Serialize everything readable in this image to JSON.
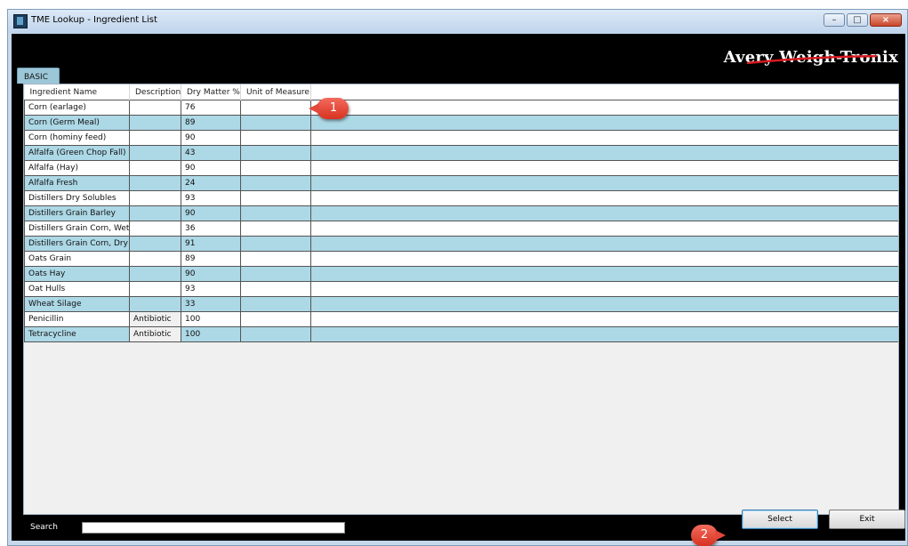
{
  "window": {
    "title": "TME Lookup - Ingredient List"
  },
  "window_buttons": {
    "minimize": "–",
    "maximize": "□",
    "close": "×"
  },
  "logo": {
    "text": "Avery Weigh-Tronix"
  },
  "tabs": [
    {
      "label": "BASIC"
    }
  ],
  "table": {
    "columns": [
      "Ingredient Name",
      "Description",
      "Dry Matter %",
      "Unit of Measure"
    ],
    "rows": [
      [
        "Corn (earlage)",
        "",
        "76",
        ""
      ],
      [
        "Corn (Germ Meal)",
        "",
        "89",
        ""
      ],
      [
        "Corn (hominy feed)",
        "",
        "90",
        ""
      ],
      [
        "Alfalfa (Green Chop Fall)",
        "",
        "43",
        ""
      ],
      [
        "Alfalfa (Hay)",
        "",
        "90",
        ""
      ],
      [
        "Alfalfa Fresh",
        "",
        "24",
        ""
      ],
      [
        "Distillers Dry Solubles",
        "",
        "93",
        ""
      ],
      [
        "Distillers Grain Barley",
        "",
        "90",
        ""
      ],
      [
        "Distillers Grain Corn, Wet",
        "",
        "36",
        ""
      ],
      [
        "Distillers Grain Corn, Dry",
        "",
        "91",
        ""
      ],
      [
        "Oats Grain",
        "",
        "89",
        ""
      ],
      [
        "Oats Hay",
        "",
        "90",
        ""
      ],
      [
        "Oat Hulls",
        "",
        "93",
        ""
      ],
      [
        "Wheat Silage",
        "",
        "33",
        ""
      ],
      [
        "Penicillin",
        "Antibiotic",
        "100",
        ""
      ],
      [
        "Tetracycline",
        "Antibiotic",
        "100",
        ""
      ]
    ]
  },
  "search": {
    "label": "Search",
    "value": ""
  },
  "buttons": {
    "select": "Select",
    "exit": "Exit"
  },
  "callouts": [
    "1",
    "2"
  ],
  "colors": {
    "row_alt": "#add8e6",
    "client_bg": "#000000",
    "callout": "#e4483a"
  }
}
